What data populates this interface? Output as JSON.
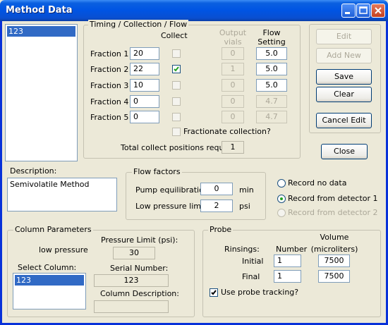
{
  "window": {
    "title": "Method Data"
  },
  "method_list": {
    "items": [
      "123"
    ]
  },
  "timing": {
    "legend": "Timing / Collection / Flow",
    "col_collect": "Collect",
    "col_output_1": "Output",
    "col_output_2": "vials",
    "col_flow_1": "Flow",
    "col_flow_2": "Setting",
    "fractions": [
      {
        "label": "Fraction 1",
        "value": "20",
        "collect": false,
        "vials": "0",
        "flow": "5.0"
      },
      {
        "label": "Fraction 2",
        "value": "22",
        "collect": true,
        "vials": "1",
        "flow": "5.0"
      },
      {
        "label": "Fraction 3",
        "value": "10",
        "collect": false,
        "vials": "0",
        "flow": "5.0"
      },
      {
        "label": "Fraction 4",
        "value": "0",
        "collect": false,
        "vials": "0",
        "flow": "4.7"
      },
      {
        "label": "Fraction 5",
        "value": "0",
        "collect": false,
        "vials": "0",
        "flow": "4.7"
      }
    ],
    "fractionate_label": "Fractionate collection?",
    "total_label": "Total collect positions required:",
    "total_value": "1"
  },
  "buttons": {
    "edit": "Edit",
    "add_new": "Add New",
    "save": "Save",
    "clear": "Clear",
    "cancel_edit": "Cancel Edit",
    "close": "Close"
  },
  "description": {
    "label": "Description:",
    "value": "Semivolatile Method"
  },
  "flow_factors": {
    "legend": "Flow factors",
    "pump_label": "Pump equilibration",
    "pump_value": "0",
    "pump_unit": "min",
    "lowp_label": "Low pressure limit",
    "lowp_value": "2",
    "lowp_unit": "psi"
  },
  "record": {
    "options": [
      "Record no data",
      "Record from detector 1",
      "Record from detector 2"
    ],
    "selected": "Record from detector 1"
  },
  "column_params": {
    "legend": "Column Parameters",
    "pressure_label": "Pressure Limit (psi):",
    "pressure_value": "30",
    "type_text": "low pressure",
    "select_label": "Select Column:",
    "columns": [
      "123"
    ],
    "serial_label": "Serial Number:",
    "serial_value": "123",
    "desc_label": "Column Description:",
    "desc_value": ""
  },
  "probe": {
    "legend": "Probe",
    "volume_1": "Volume",
    "volume_2": "(microliters)",
    "rinsings_label": "Rinsings:",
    "number_label": "Number",
    "initial_label": "Initial",
    "initial_number": "1",
    "initial_volume": "7500",
    "final_label": "Final",
    "final_number": "1",
    "final_volume": "7500",
    "tracking_label": "Use probe tracking?",
    "tracking_checked": true
  }
}
